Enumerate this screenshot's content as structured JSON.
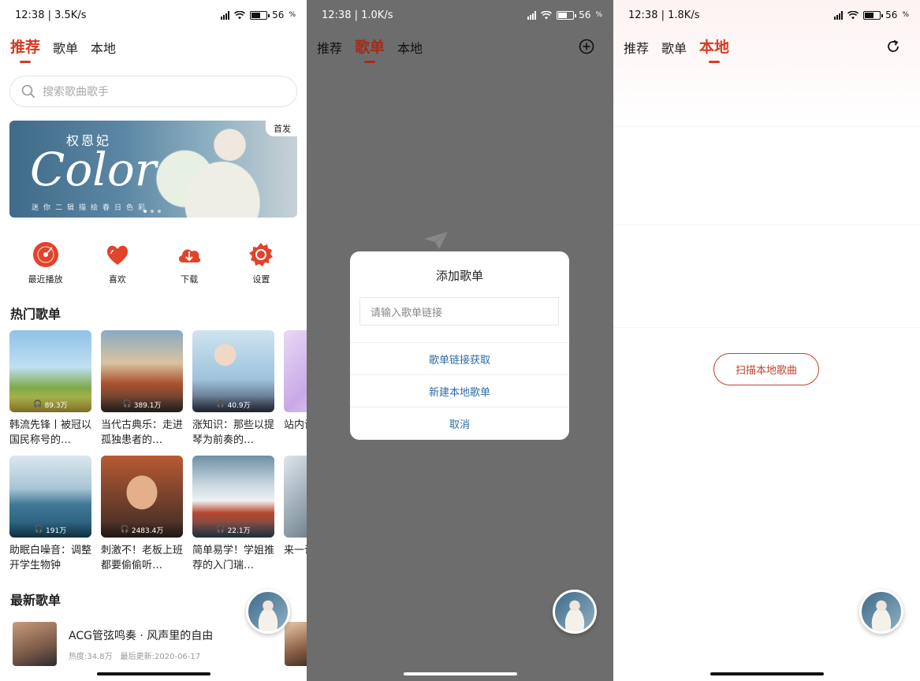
{
  "screens": [
    {
      "status": {
        "time": "12:38",
        "speed": "3.5K/s",
        "battery": "56"
      },
      "tabs": [
        "推荐",
        "歌单",
        "本地"
      ],
      "active_tab": 0,
      "search": {
        "placeholder": "搜索歌曲歌手"
      },
      "banner": {
        "artist": "权恩妃",
        "title": "Color",
        "subtitle": "迷你二辑描绘春日色彩",
        "badge": "首发",
        "page_count": 3,
        "current_page": 1
      },
      "quick_actions": [
        {
          "label": "最近播放",
          "icon": "disc-icon"
        },
        {
          "label": "喜欢",
          "icon": "heart-icon"
        },
        {
          "label": "下载",
          "icon": "download-cloud-icon"
        },
        {
          "label": "设置",
          "icon": "gear-icon"
        }
      ],
      "hot_section_title": "热门歌单",
      "hot_playlists_row1": [
        {
          "plays": "89.3万",
          "title": "韩流先锋丨被冠以国民称号的…"
        },
        {
          "plays": "389.1万",
          "title": "当代古典乐：走进孤独患者的…"
        },
        {
          "plays": "40.9万",
          "title": "涨知识：那些以提琴为前奏的…"
        },
        {
          "plays": "",
          "title": "站内设热日记"
        }
      ],
      "hot_playlists_row2": [
        {
          "plays": "191万",
          "title": "助眠白噪音：调整开学生物钟"
        },
        {
          "plays": "2483.4万",
          "title": "刺激不！老板上班都要偷偷听…"
        },
        {
          "plays": "22.1万",
          "title": "简单易学！学姐推荐的入门瑞…"
        },
        {
          "plays": "",
          "title": "来一说，我"
        }
      ],
      "new_section_title": "最新歌单",
      "new_playlist": {
        "title": "ACG管弦鸣奏 · 风声里的自由",
        "heat": "热度:34.8万",
        "updated": "最后更新:2020-06-17"
      }
    },
    {
      "status": {
        "time": "12:38",
        "speed": "1.0K/s",
        "battery": "56"
      },
      "tabs": [
        "推荐",
        "歌单",
        "本地"
      ],
      "active_tab": 1,
      "dialog": {
        "title": "添加歌单",
        "input_placeholder": "请输入歌单链接",
        "actions": [
          "歌单链接获取",
          "新建本地歌单",
          "取消"
        ]
      }
    },
    {
      "status": {
        "time": "12:38",
        "speed": "1.8K/s",
        "battery": "56"
      },
      "tabs": [
        "推荐",
        "歌单",
        "本地"
      ],
      "active_tab": 2,
      "scan_button": "扫描本地歌曲"
    }
  ],
  "colors": {
    "accent": "#d83a22",
    "link_blue": "#2e6ca3",
    "overlay": "#6d6d6d"
  }
}
